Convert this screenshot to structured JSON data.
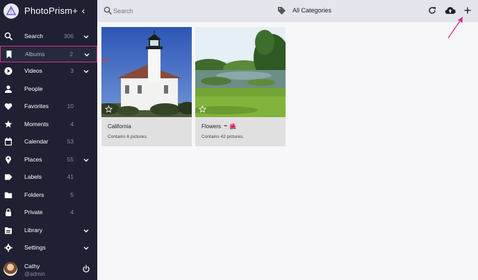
{
  "app": {
    "name": "PhotoPrism+"
  },
  "sidebar": {
    "items": [
      {
        "label": "Search",
        "count": "306",
        "icon": "search-icon",
        "expandable": true
      },
      {
        "label": "Albums",
        "count": "2",
        "icon": "bookmark-icon",
        "expandable": true,
        "active": true
      },
      {
        "label": "Videos",
        "count": "3",
        "icon": "play-circle-icon",
        "expandable": true
      },
      {
        "label": "People",
        "count": "",
        "icon": "person-icon",
        "expandable": false
      },
      {
        "label": "Favorites",
        "count": "10",
        "icon": "heart-icon",
        "expandable": false
      },
      {
        "label": "Moments",
        "count": "4",
        "icon": "star-icon",
        "expandable": false
      },
      {
        "label": "Calendar",
        "count": "53",
        "icon": "calendar-icon",
        "expandable": false
      },
      {
        "label": "Places",
        "count": "55",
        "icon": "map-pin-icon",
        "expandable": true
      },
      {
        "label": "Labels",
        "count": "41",
        "icon": "label-icon",
        "expandable": false
      },
      {
        "label": "Folders",
        "count": "5",
        "icon": "folder-icon",
        "expandable": false
      },
      {
        "label": "Private",
        "count": "4",
        "icon": "lock-icon",
        "expandable": false
      },
      {
        "label": "Library",
        "count": "",
        "icon": "library-icon",
        "expandable": true
      },
      {
        "label": "Settings",
        "count": "",
        "icon": "gear-icon",
        "expandable": true
      }
    ],
    "user": {
      "name": "Cathy",
      "role": "@admin"
    }
  },
  "toolbar": {
    "search_placeholder": "Search",
    "category": "All Categories"
  },
  "albums": [
    {
      "title": "California",
      "subtitle": "Contains 6 pictures.",
      "image": "lighthouse-photo"
    },
    {
      "title": "Flowers ☕🌺",
      "subtitle": "Contains 42 pictures.",
      "image": "meadow-photo"
    }
  ],
  "colors": {
    "sidebar_bg": "#1f2132",
    "toolbar_bg": "#e4e4ec",
    "highlight": "#d6317f",
    "card_bg": "#e0e0e0"
  }
}
